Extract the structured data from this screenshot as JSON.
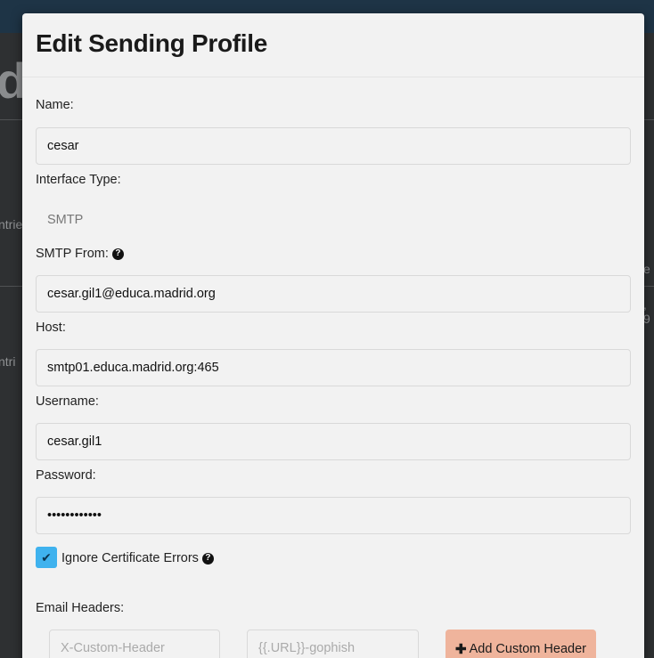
{
  "background": {
    "title_fragment": "d",
    "text_left_1": "ntrie",
    "text_left_2": "ntri",
    "text_right_1": "e",
    "text_right_2": ", 9"
  },
  "modal": {
    "title": "Edit Sending Profile",
    "fields": {
      "name": {
        "label": "Name:",
        "value": "cesar"
      },
      "interface_type": {
        "label": "Interface Type:",
        "value": "SMTP"
      },
      "smtp_from": {
        "label": "SMTP From:",
        "value": "cesar.gil1@educa.madrid.org"
      },
      "host": {
        "label": "Host:",
        "value": "smtp01.educa.madrid.org:465"
      },
      "username": {
        "label": "Username:",
        "value": "cesar.gil1"
      },
      "password": {
        "label": "Password:",
        "value": "••••••••••••"
      }
    },
    "ignore_cert": {
      "label": "Ignore Certificate Errors",
      "checked": true
    },
    "email_headers": {
      "label": "Email Headers:",
      "header_placeholder": "X-Custom-Header",
      "value_placeholder": "{{.URL}}-gophish",
      "add_button_label": "Add Custom Header"
    },
    "colors": {
      "checkbox": "#3fb2ee",
      "add_button": "#efb49c"
    }
  }
}
